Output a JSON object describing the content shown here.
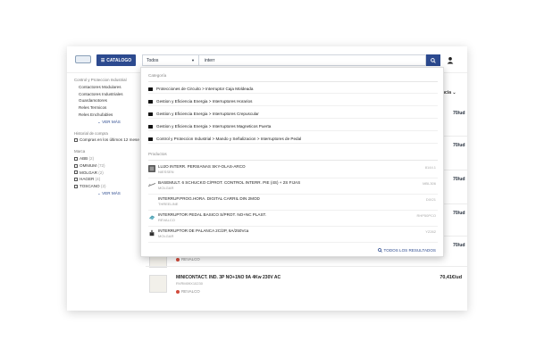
{
  "header": {
    "catalog_label": "CATALOGO",
    "category_select": "Todos",
    "search_value": "interr"
  },
  "sidebar": {
    "cat_head": "Control y Proteccion Industrial",
    "cat_items": [
      "Contactores Modulares",
      "Contactores Industriales",
      "Guardamotores",
      "Reles Termicos",
      "Reles Enchufables"
    ],
    "ver_mas": "VER MÁS",
    "history_head": "Historial de compra",
    "history_item": "Compras en los últimos 12 mese",
    "brand_head": "Marca",
    "brands": [
      {
        "name": "ABB",
        "count": "(2)"
      },
      {
        "name": "OMNIUM",
        "count": "(72)"
      },
      {
        "name": "MOLGAR",
        "count": "(2)"
      },
      {
        "name": "HAGER",
        "count": "(4)"
      },
      {
        "name": "TOSCANO",
        "count": "(2)"
      }
    ],
    "ver_mas2": "VER MÁS"
  },
  "list": {
    "sort_label": "ncia",
    "prices": [
      "70/ud",
      "70/ud",
      "70/ud",
      "70/ud",
      "70/ud"
    ],
    "product1_brand": "REVALCO",
    "product2": {
      "name": "MINICONTACT. IND. 3P NO+1NO 9A 4Kw 230V AC",
      "code": "RVRM09X10230",
      "brand": "REVALCO",
      "price": "70,41€/ud"
    }
  },
  "dropdown": {
    "cat_label": "Categoría",
    "categories": [
      "Protecciones de Circuito > Interruptor Caja Moldeada",
      "Gestion y Eficiencia Energia > Interruptores Horarios",
      "Gestion y Eficiencia Energia > Interruptores Crepuscular",
      "Gestion y Eficiencia Energia > Interruptores Magneticos Puerta",
      "Control y Proteccion Industrial > Mando y Señalizacion > Interruptores de Pedal"
    ],
    "prod_label": "Productos",
    "products": [
      {
        "name": "LUJO INTERR. PERSIANAS SKY-OLAS-ARCO",
        "brand": "NIESSEN",
        "code": "8144.1"
      },
      {
        "name": "BASEMULT. 6 SCHUCKO C/PROT. CONTROL INTERR. PIE (4S) + 2S FIJAS",
        "brand": "MOLGAR",
        "code": "MBL306"
      },
      {
        "name": "INTERRUP.PROG.HORA. DIGITAL CARRIL DIN 2MOD",
        "brand": "THREELINE",
        "code": "DIX21"
      },
      {
        "name": "INTERRUPTOR PEDAL BASICO S/PROT. NO+NC PLAST.",
        "brand": "REVALCO",
        "code": "RHP50PCO"
      },
      {
        "name": "INTERRUPTOR DE PALANCA 2C/2P, 6A/250Vca",
        "brand": "MOLGAR",
        "code": "YZ262"
      }
    ],
    "all_results": "TODOS LOS RESULTADOS"
  }
}
